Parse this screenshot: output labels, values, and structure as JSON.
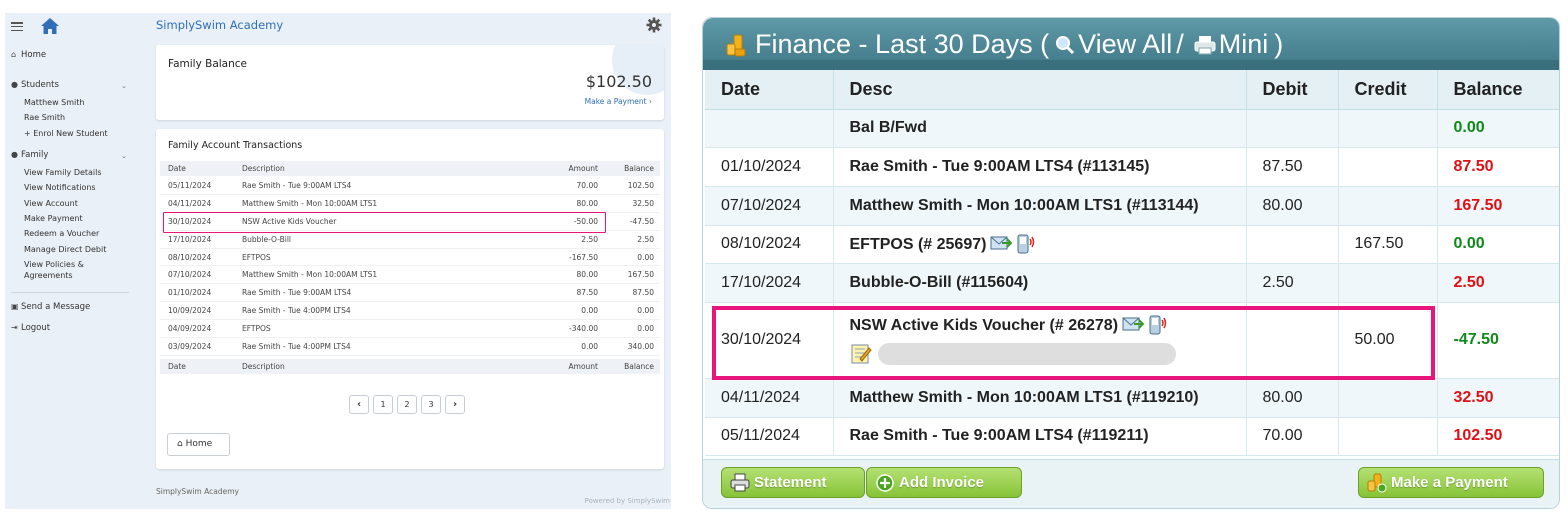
{
  "portal": {
    "brand": "SimplySwim Academy",
    "sidebar": {
      "home": "Home",
      "students_label": "Students",
      "students": [
        "Matthew Smith",
        "Rae Smith",
        "+ Enrol New Student"
      ],
      "family_label": "Family",
      "family_items": [
        "View Family Details",
        "View Notifications",
        "View Account",
        "Make Payment",
        "Redeem a Voucher",
        "Manage Direct Debit",
        "View Policies &",
        "Agreements"
      ],
      "send_message": "Send a Message",
      "logout": "Logout"
    },
    "balance": {
      "title": "Family Balance",
      "amount": "$102.50",
      "pay_link": "Make a Payment ›"
    },
    "transactions": {
      "title": "Family Account Transactions",
      "columns": [
        "Date",
        "Description",
        "Amount",
        "Balance"
      ],
      "rows": [
        {
          "date": "05/11/2024",
          "desc": "Rae Smith - Tue 9:00AM LTS4",
          "amount": "70.00",
          "balance": "102.50"
        },
        {
          "date": "04/11/2024",
          "desc": "Matthew Smith - Mon 10:00AM LTS1",
          "amount": "80.00",
          "balance": "32.50"
        },
        {
          "date": "30/10/2024",
          "desc": "NSW Active Kids Voucher",
          "amount": "-50.00",
          "balance": "-47.50"
        },
        {
          "date": "17/10/2024",
          "desc": "Bubble-O-Bill",
          "amount": "2.50",
          "balance": "2.50"
        },
        {
          "date": "08/10/2024",
          "desc": "EFTPOS",
          "amount": "-167.50",
          "balance": "0.00"
        },
        {
          "date": "07/10/2024",
          "desc": "Matthew Smith - Mon 10:00AM LTS1",
          "amount": "80.00",
          "balance": "167.50"
        },
        {
          "date": "01/10/2024",
          "desc": "Rae Smith - Tue 9:00AM LTS4",
          "amount": "87.50",
          "balance": "87.50"
        },
        {
          "date": "10/09/2024",
          "desc": "Rae Smith - Tue 4:00PM LTS4",
          "amount": "0.00",
          "balance": "0.00"
        },
        {
          "date": "04/09/2024",
          "desc": "EFTPOS",
          "amount": "-340.00",
          "balance": "0.00"
        },
        {
          "date": "03/09/2024",
          "desc": "Rae Smith - Tue 4:00PM LTS4",
          "amount": "0.00",
          "balance": "340.00"
        }
      ]
    },
    "pager": {
      "prev": "‹",
      "pages": [
        "1",
        "2",
        "3"
      ],
      "next": "›"
    },
    "home_button": "Home",
    "footer_left": "SimplySwim Academy",
    "footer_right": "Powered by SimplySwim"
  },
  "finance": {
    "title_main": "Finance - Last 30 Days (",
    "view_all": "View All",
    "slash": "/",
    "mini": "Mini",
    "close_paren": ")",
    "columns": [
      "Date",
      "Desc",
      "Debit",
      "Credit",
      "Balance"
    ],
    "rows": [
      {
        "date": "",
        "desc": "Bal B/Fwd",
        "debit": "",
        "credit": "",
        "balance": "0.00",
        "sign": "pos",
        "icons": false
      },
      {
        "date": "01/10/2024",
        "desc": "Rae Smith - Tue 9:00AM LTS4 (#113145)",
        "debit": "87.50",
        "credit": "",
        "balance": "87.50",
        "sign": "neg",
        "icons": false
      },
      {
        "date": "07/10/2024",
        "desc": "Matthew Smith - Mon 10:00AM LTS1 (#113144)",
        "debit": "80.00",
        "credit": "",
        "balance": "167.50",
        "sign": "neg",
        "icons": false
      },
      {
        "date": "08/10/2024",
        "desc": "EFTPOS (# 25697)",
        "debit": "",
        "credit": "167.50",
        "balance": "0.00",
        "sign": "pos",
        "icons": true
      },
      {
        "date": "17/10/2024",
        "desc": "Bubble-O-Bill (#115604)",
        "debit": "2.50",
        "credit": "",
        "balance": "2.50",
        "sign": "neg",
        "icons": false
      },
      {
        "date": "30/10/2024",
        "desc": "NSW Active Kids Voucher (# 26278)",
        "debit": "",
        "credit": "50.00",
        "balance": "-47.50",
        "sign": "pos",
        "icons": true,
        "note": true
      },
      {
        "date": "04/11/2024",
        "desc": "Matthew Smith - Mon 10:00AM LTS1 (#119210)",
        "debit": "80.00",
        "credit": "",
        "balance": "32.50",
        "sign": "neg",
        "icons": false
      },
      {
        "date": "05/11/2024",
        "desc": "Rae Smith - Tue 9:00AM LTS4 (#119211)",
        "debit": "70.00",
        "credit": "",
        "balance": "102.50",
        "sign": "neg",
        "icons": false
      }
    ],
    "buttons": {
      "statement": "Statement",
      "add_invoice": "Add Invoice",
      "make_payment": "Make a Payment"
    },
    "colors": {
      "positive": "#0f8a1a",
      "negative": "#e00f14",
      "highlight": "#e8157d",
      "header": "#4a8494",
      "button_green": "#86c337"
    }
  }
}
